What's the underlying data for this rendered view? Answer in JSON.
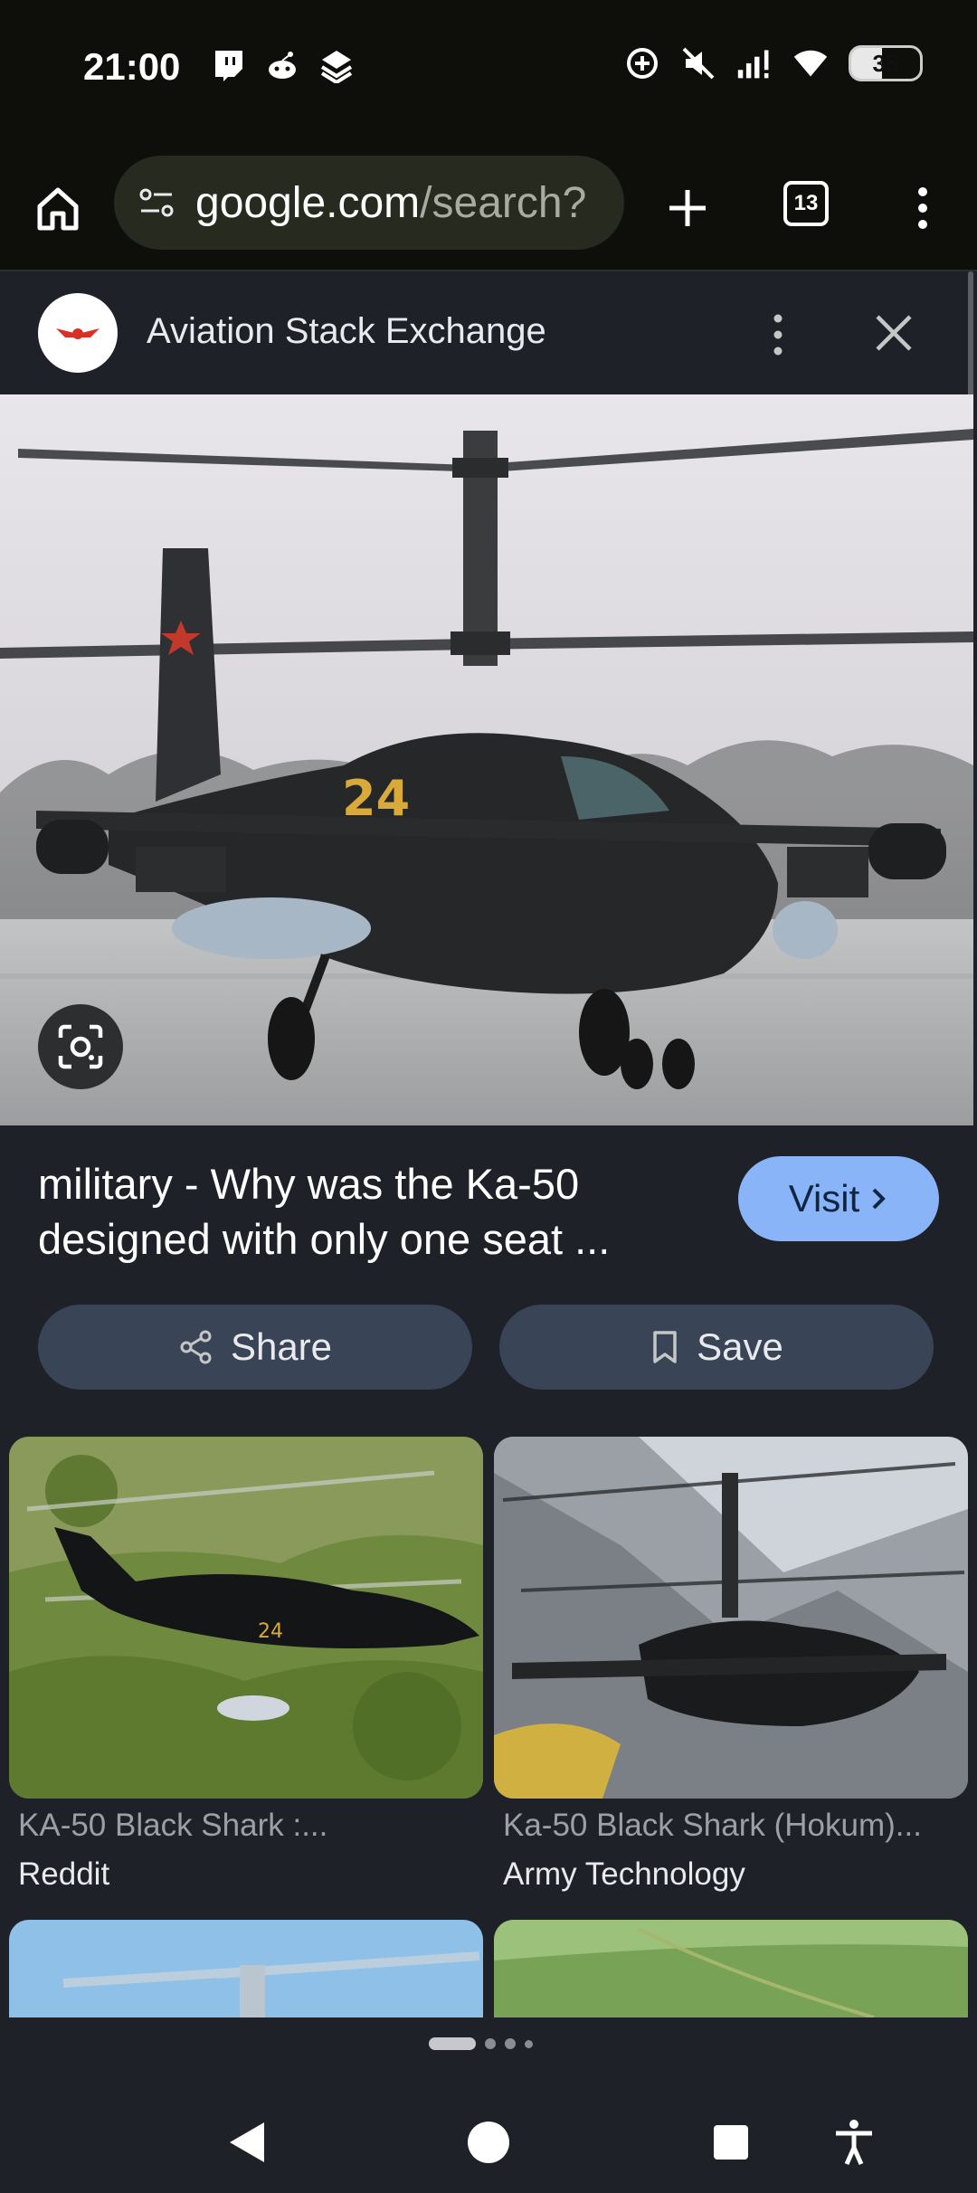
{
  "status_bar": {
    "time": "21:00",
    "left_icons": [
      "twitch-icon",
      "reddit-icon",
      "stack-icon"
    ],
    "right_icons": [
      "sync-icon",
      "mute-icon",
      "signal-icon",
      "wifi-icon"
    ],
    "battery": "35"
  },
  "browser": {
    "url_host": "google.com",
    "url_path": "/search?",
    "tab_count": "13"
  },
  "panel": {
    "site_name": "Aviation Stack Exchange",
    "result_title": "military - Why was the Ka-50 designed with only one seat ...",
    "visit_label": "Visit",
    "share_label": "Share",
    "save_label": "Save"
  },
  "related": [
    {
      "caption": "KA-50 Black Shark :...",
      "source": "Reddit"
    },
    {
      "caption": "Ka-50 Black Shark (Hokum)...",
      "source": "Army Technology"
    }
  ],
  "colors": {
    "accent": "#8ab4f8",
    "button_bg": "#394457",
    "background": "#1f2128",
    "toolbar_bg": "#0e0f0b"
  }
}
